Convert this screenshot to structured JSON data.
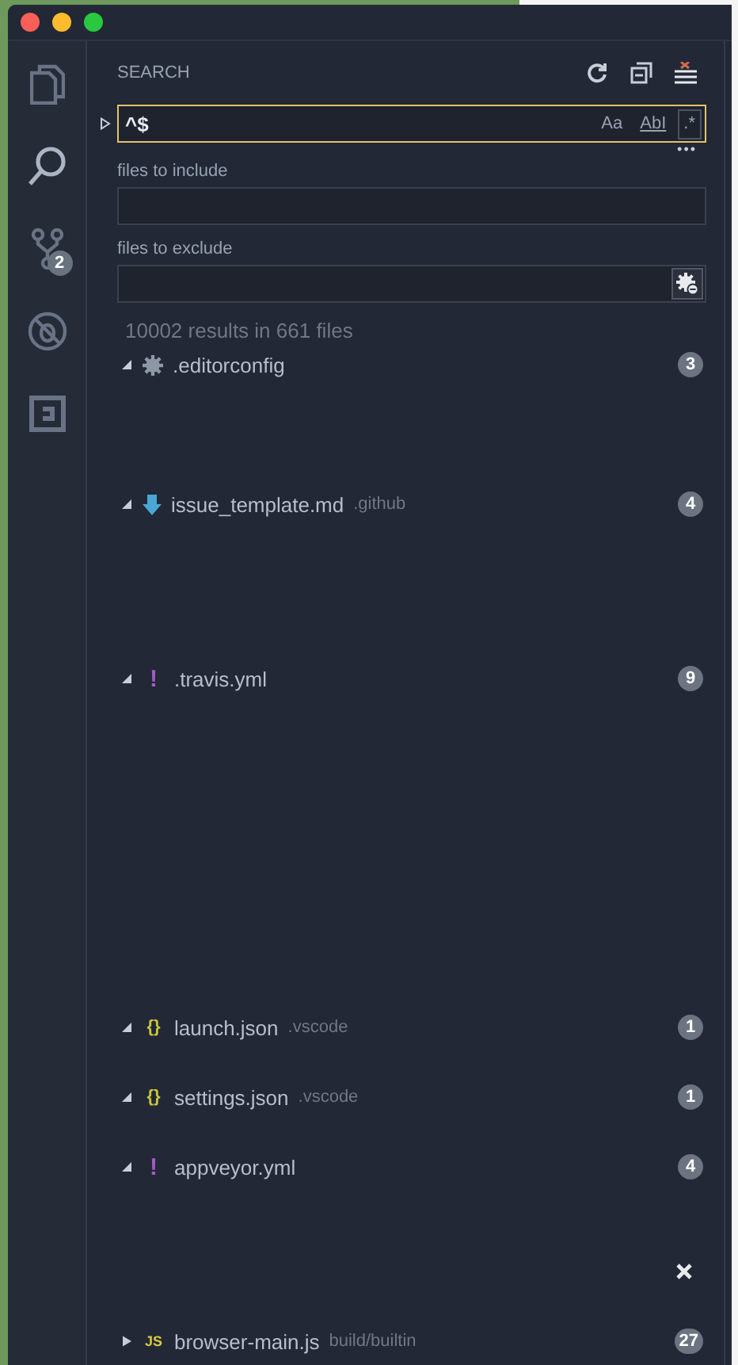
{
  "window": {
    "controls": [
      {
        "kind": "close"
      },
      {
        "kind": "minimize"
      },
      {
        "kind": "zoom"
      }
    ]
  },
  "activity_bar": [
    {
      "kind": "files",
      "selected": false
    },
    {
      "kind": "search",
      "selected": true
    },
    {
      "kind": "git",
      "selected": false,
      "badge": "2"
    },
    {
      "kind": "debug",
      "selected": false
    },
    {
      "kind": "extensions",
      "selected": false
    }
  ],
  "sidebar": {
    "title": "SEARCH",
    "search": {
      "value": "^$",
      "details_expanded": false,
      "options": [
        {
          "label": "Aa",
          "selected": false
        },
        {
          "label": "AbI",
          "selected": false
        },
        {
          "label": ".*",
          "selected": true
        }
      ]
    },
    "more": "•••",
    "include": {
      "label": "files to include"
    },
    "exclude": {
      "label": "files to exclude",
      "use_ignore": true
    },
    "summary": "10002 results in 661 files",
    "files": [
      {
        "name": ".editorconfig",
        "kind": "gear",
        "expanded": true,
        "count": "3",
        "remove_shown": false
      },
      {
        "name": "issue_template.md",
        "folder": ".github",
        "kind": "arrow",
        "expanded": true,
        "count": "4",
        "remove_shown": false
      },
      {
        "name": ".travis.yml",
        "kind": "text",
        "icon_text": "!",
        "color": "#a35bc7",
        "expanded": true,
        "count": "9",
        "remove_shown": false
      },
      {
        "name": "launch.json",
        "folder": ".vscode",
        "kind": "text",
        "icon_text": "{}",
        "color": "#c7c53a",
        "expanded": true,
        "count": "1",
        "remove_shown": false
      },
      {
        "name": "settings.json",
        "folder": ".vscode",
        "kind": "text",
        "icon_text": "{}",
        "color": "#c7c53a",
        "expanded": true,
        "count": "1",
        "remove_shown": false
      },
      {
        "name": "appveyor.yml",
        "kind": "text",
        "icon_text": "!",
        "color": "#a35bc7",
        "expanded": true,
        "count": "4",
        "remove_shown": true
      },
      {
        "name": "browser-main.js",
        "folder": "build/builtin",
        "kind": "text",
        "icon_text": "JS",
        "color": "#d6c840",
        "expanded": false,
        "count": "27",
        "remove_shown": false
      }
    ]
  }
}
